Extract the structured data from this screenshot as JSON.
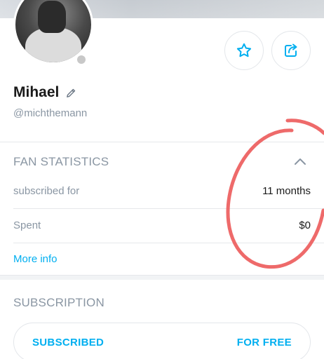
{
  "profile": {
    "name": "Mihael",
    "handle": "@michthemann"
  },
  "actions": {
    "favorite_icon": "star-icon",
    "share_icon": "share-icon",
    "edit_icon": "pencil-icon"
  },
  "fan_statistics": {
    "title": "FAN STATISTICS",
    "rows": [
      {
        "label": "subscribed for",
        "value": "11 months"
      },
      {
        "label": "Spent",
        "value": "$0"
      }
    ],
    "more_info": "More info"
  },
  "subscription": {
    "title": "SUBSCRIPTION",
    "status_label": "SUBSCRIBED",
    "price_label": "FOR FREE"
  },
  "colors": {
    "accent": "#00aff0",
    "muted_text": "#8a96a3",
    "annotation_red": "#ec5a5a"
  }
}
